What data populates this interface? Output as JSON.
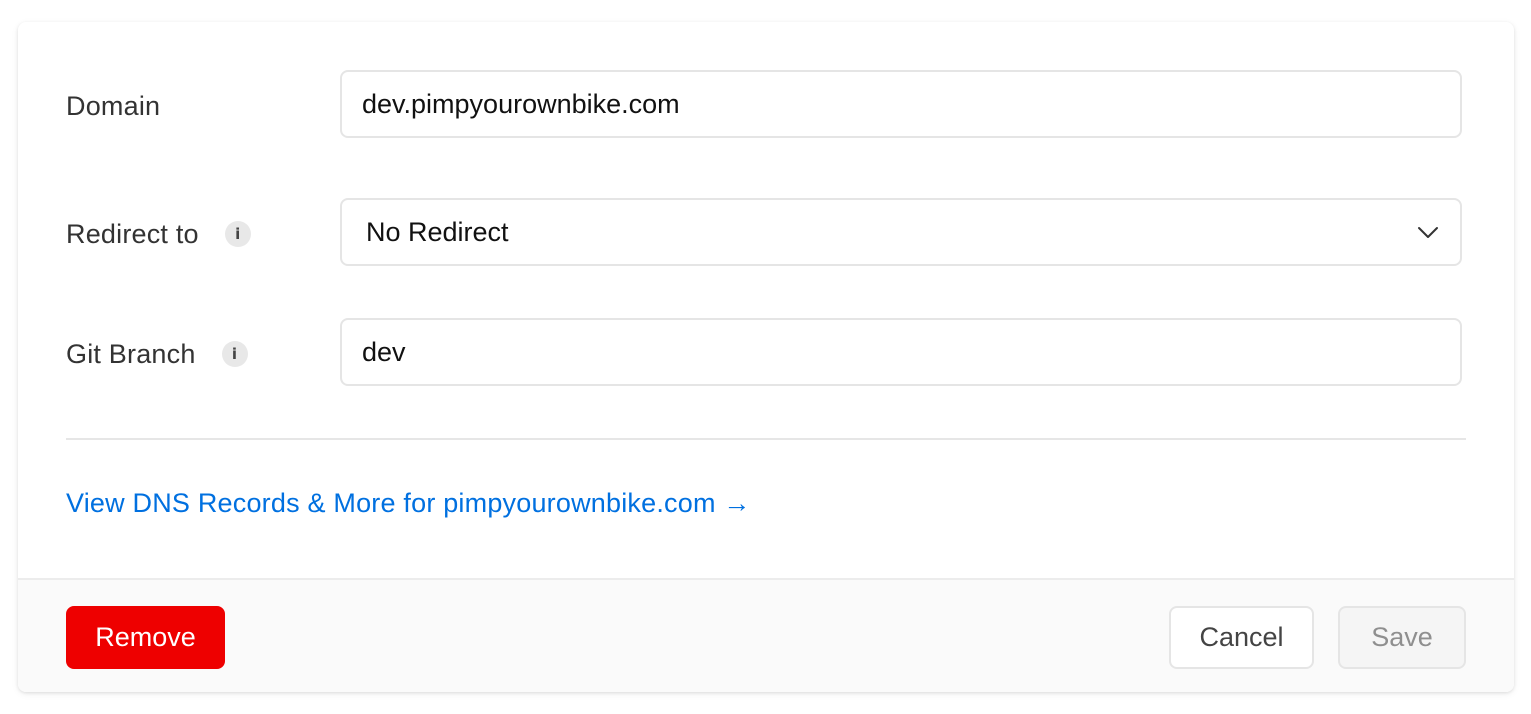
{
  "form": {
    "domain": {
      "label": "Domain",
      "value": "dev.pimpyourownbike.com"
    },
    "redirect": {
      "label": "Redirect to",
      "info_icon": "i",
      "selected": "No Redirect"
    },
    "git_branch": {
      "label": "Git Branch",
      "info_icon": "i",
      "value": "dev"
    }
  },
  "dns_link": {
    "label": "View DNS Records & More for pimpyourownbike.com →"
  },
  "footer": {
    "remove_label": "Remove",
    "cancel_label": "Cancel",
    "save_label": "Save"
  },
  "colors": {
    "link": "#0070e0",
    "danger": "#ee0000",
    "border": "#e5e5e5"
  },
  "icons": [
    "info-icon",
    "chevron-down-icon",
    "arrow-right-icon"
  ]
}
